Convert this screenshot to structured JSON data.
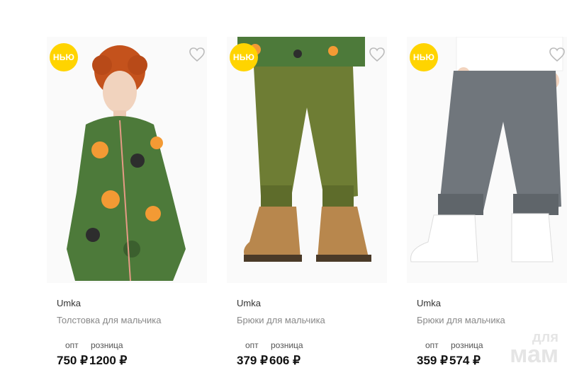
{
  "products": [
    {
      "badge": "НЬЮ",
      "brand": "Umka",
      "name": "Толстовка для мальчика",
      "opt_label": "опт",
      "retail_label": "розница",
      "opt_price": "750 ₽",
      "retail_price": "1200 ₽"
    },
    {
      "badge": "НЬЮ",
      "brand": "Umka",
      "name": "Брюки для мальчика",
      "opt_label": "опт",
      "retail_label": "розница",
      "opt_price": "379 ₽",
      "retail_price": "606 ₽"
    },
    {
      "badge": "НЬЮ",
      "brand": "Umka",
      "name": "Брюки для мальчика",
      "opt_label": "опт",
      "retail_label": "розница",
      "opt_price": "359 ₽",
      "retail_price": "574 ₽"
    }
  ],
  "watermark": {
    "line1": "для",
    "line2": "мам"
  },
  "colors": {
    "badge": "#ffd400",
    "name_text": "#888888",
    "price_text": "#111111"
  },
  "icons": {
    "favorite": "heart-outline-icon"
  }
}
